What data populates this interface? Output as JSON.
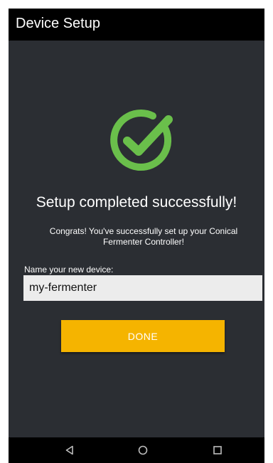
{
  "app_bar": {
    "title": "Device Setup"
  },
  "success": {
    "icon": "check-circle-icon",
    "accent_color": "#6abf4b",
    "headline": "Setup completed successfully!",
    "message": "Congrats! You've successfully set up your Conical Fermenter Controller!"
  },
  "device_name": {
    "label": "Name your new device:",
    "value": "my-fermenter"
  },
  "done_button": {
    "label": "DONE",
    "color": "#f5b400"
  },
  "nav_bar": {
    "icons": [
      "back-icon",
      "home-icon",
      "recents-icon"
    ]
  }
}
